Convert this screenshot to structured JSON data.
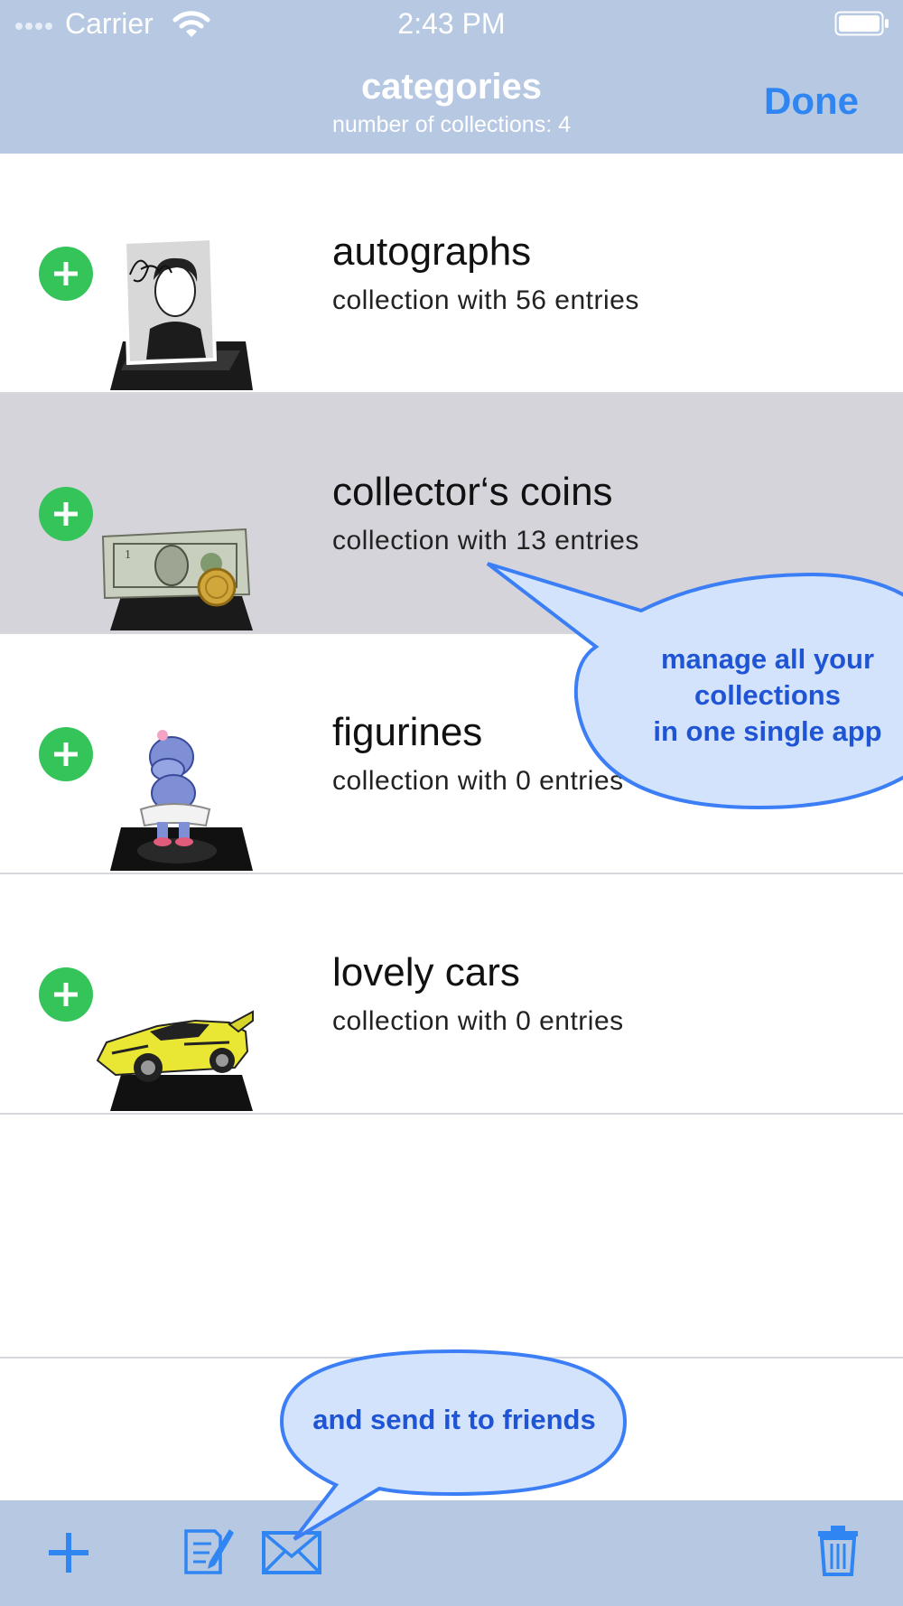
{
  "status_bar": {
    "carrier": "Carrier",
    "time": "2:43 PM"
  },
  "nav": {
    "title": "categories",
    "subtitle": "number of collections: 4",
    "done_label": "Done"
  },
  "collections": [
    {
      "title": "autographs",
      "subtitle": "collection with 56 entries",
      "thumbnail": "autograph-portrait-icon",
      "selected": false
    },
    {
      "title": "collector‘s coins",
      "subtitle": "collection with 13 entries",
      "thumbnail": "dollar-bill-coin-icon",
      "selected": true
    },
    {
      "title": "figurines",
      "subtitle": "collection with 0 entries",
      "thumbnail": "hippo-figurine-icon",
      "selected": false
    },
    {
      "title": "lovely cars",
      "subtitle": "collection with 0 entries",
      "thumbnail": "yellow-sports-car-icon",
      "selected": false
    }
  ],
  "callouts": {
    "manage": [
      "manage all your",
      "collections",
      "in one single app"
    ],
    "send": "and send it to friends"
  },
  "toolbar": {
    "icons": [
      "plus-icon",
      "edit-note-icon",
      "mail-icon",
      "trash-icon"
    ]
  },
  "colors": {
    "bar": "#b6c8e2",
    "accent": "#2f86f2",
    "add_green": "#34c45a",
    "selected_row": "#d5d4da",
    "callout_fill": "#d3e3fb",
    "callout_text": "#1f55d4"
  }
}
